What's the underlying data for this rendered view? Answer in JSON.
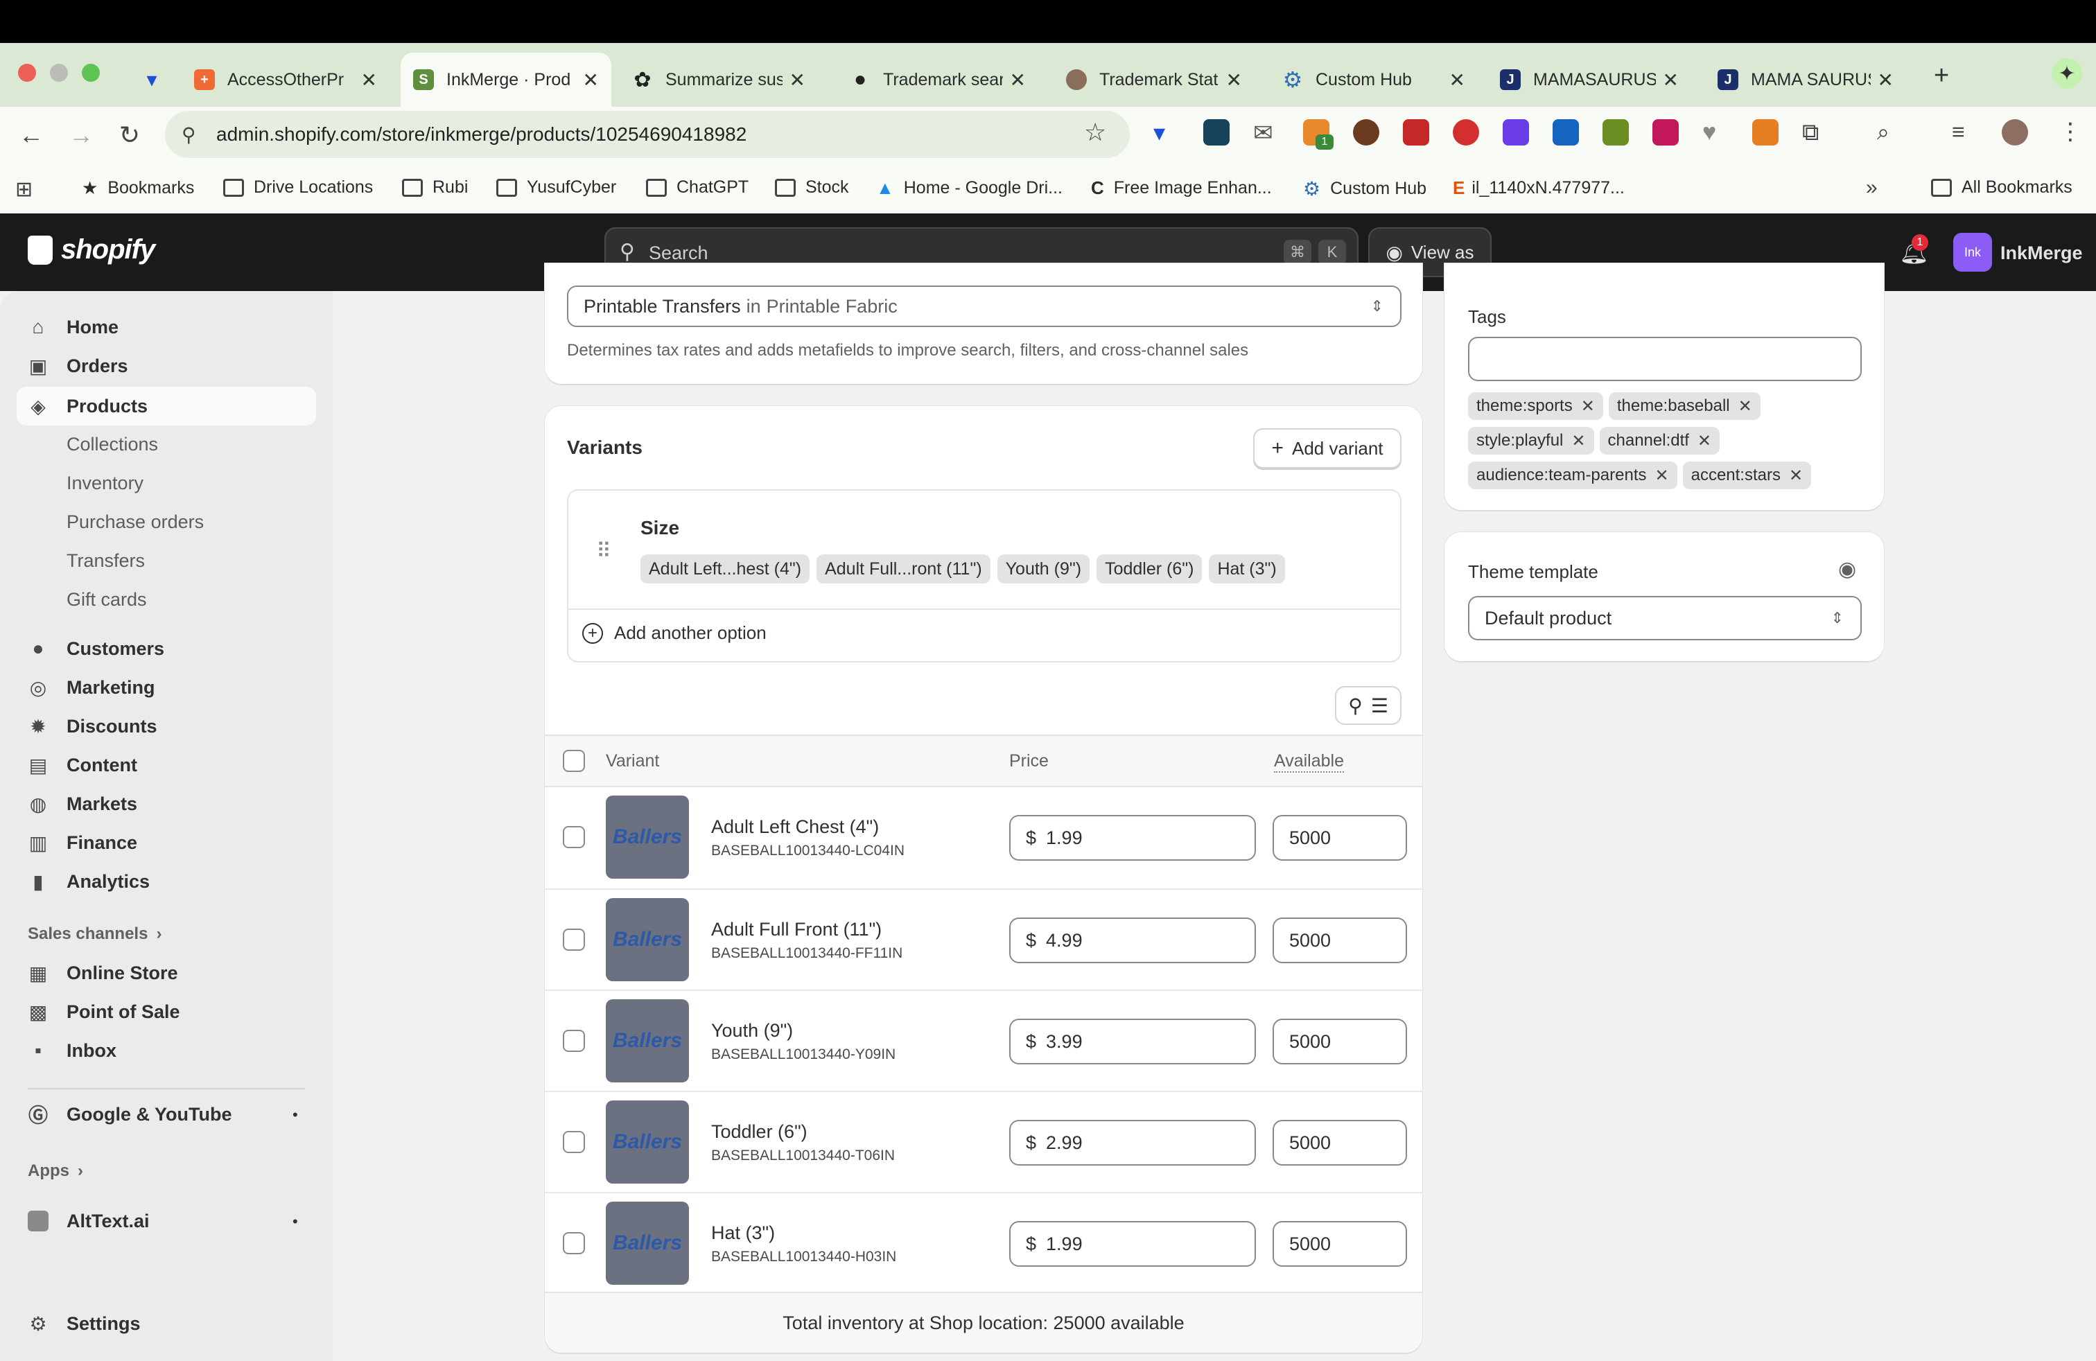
{
  "browser": {
    "tabs": [
      {
        "label": "",
        "icon": "vpn-icon"
      },
      {
        "label": "AccessOtherPr",
        "icon": "app-icon"
      },
      {
        "label": "InkMerge · Prod",
        "icon": "shopify-icon"
      },
      {
        "label": "Summarize sus",
        "icon": "chatgpt-icon"
      },
      {
        "label": "Trademark sear",
        "icon": "location-pin-icon"
      },
      {
        "label": "Trademark Stat",
        "icon": "seal-icon"
      },
      {
        "label": "Custom Hub",
        "icon": "gear-icon"
      },
      {
        "label": "MAMASAURUS",
        "icon": "j-icon"
      },
      {
        "label": "MAMA SAURUS",
        "icon": "j-icon"
      }
    ],
    "url": "admin.shopify.com/store/inkmerge/products/10254690418982",
    "bookmarks": [
      {
        "label": "Bookmarks"
      },
      {
        "label": "Drive Locations"
      },
      {
        "label": "Rubi"
      },
      {
        "label": "YusufCyber"
      },
      {
        "label": "ChatGPT"
      },
      {
        "label": "Stock"
      },
      {
        "label": "Home - Google Dri..."
      },
      {
        "label": "Free Image Enhan..."
      },
      {
        "label": "Custom Hub"
      },
      {
        "label": "il_1140xN.477977..."
      }
    ],
    "all_bookmarks": "All Bookmarks",
    "overflow": "»",
    "ext_badge": "1"
  },
  "shopify": {
    "logo": "shopify",
    "search_placeholder": "Search",
    "kbd_cmd": "⌘",
    "kbd_k": "K",
    "view_as": "View as",
    "notif_count": "1",
    "store_avatar": "Ink",
    "store_name": "InkMerge"
  },
  "sidebar": {
    "items": [
      {
        "label": "Home"
      },
      {
        "label": "Orders"
      },
      {
        "label": "Products"
      }
    ],
    "product_sub": [
      "Collections",
      "Inventory",
      "Purchase orders",
      "Transfers",
      "Gift cards"
    ],
    "items2": [
      {
        "label": "Customers"
      },
      {
        "label": "Marketing"
      },
      {
        "label": "Discounts"
      },
      {
        "label": "Content"
      },
      {
        "label": "Markets"
      },
      {
        "label": "Finance"
      },
      {
        "label": "Analytics"
      }
    ],
    "sales_channels": "Sales channels",
    "channels": [
      {
        "label": "Online Store"
      },
      {
        "label": "Point of Sale"
      },
      {
        "label": "Inbox"
      }
    ],
    "google": "Google & YouTube",
    "apps": "Apps",
    "alttext": "AltText.ai",
    "settings": "Settings"
  },
  "category": {
    "value": "Printable Transfers",
    "in": "in",
    "parent": "Printable Fabric",
    "help": "Determines tax rates and adds metafields to improve search, filters, and cross-channel sales"
  },
  "variants": {
    "title": "Variants",
    "add_variant": "Add variant",
    "option_name": "Size",
    "option_values": [
      "Adult Left...hest (4\")",
      "Adult Full...ront (11\")",
      "Youth (9\")",
      "Toddler (6\")",
      "Hat (3\")"
    ],
    "add_option": "Add another option",
    "col_variant": "Variant",
    "col_price": "Price",
    "col_available": "Available",
    "currency": "$",
    "thumb_text": "Ballers",
    "rows": [
      {
        "name": "Adult Left Chest (4\")",
        "sku": "BASEBALL10013440-LC04IN",
        "price": "1.99",
        "available": "5000"
      },
      {
        "name": "Adult Full Front (11\")",
        "sku": "BASEBALL10013440-FF11IN",
        "price": "4.99",
        "available": "5000"
      },
      {
        "name": "Youth (9\")",
        "sku": "BASEBALL10013440-Y09IN",
        "price": "3.99",
        "available": "5000"
      },
      {
        "name": "Toddler (6\")",
        "sku": "BASEBALL10013440-T06IN",
        "price": "2.99",
        "available": "5000"
      },
      {
        "name": "Hat (3\")",
        "sku": "BASEBALL10013440-H03IN",
        "price": "1.99",
        "available": "5000"
      }
    ],
    "total": "Total inventory at Shop location: 25000 available"
  },
  "tags": {
    "title": "Tags",
    "input_value": "",
    "items": [
      "theme:sports",
      "theme:baseball",
      "style:playful",
      "channel:dtf",
      "audience:team-parents",
      "accent:stars"
    ]
  },
  "theme_template": {
    "title": "Theme template",
    "value": "Default product"
  },
  "colors": {
    "tab_bar": "#dbe8d4",
    "shopify_header": "#1a1a1a",
    "avatar": "#8b5cf6",
    "notif": "#e22c38"
  }
}
